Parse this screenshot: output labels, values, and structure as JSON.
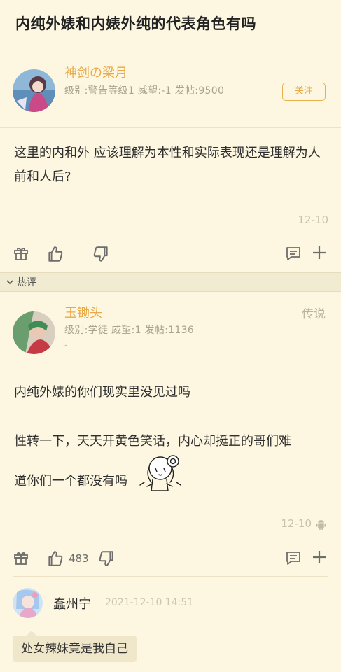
{
  "thread": {
    "title": "内纯外婊和内婊外纯的代表角色有吗"
  },
  "op": {
    "username": "神剑の梁月",
    "meta": "级别:警告等级1 威望:-1 发帖:9500",
    "dash": "-",
    "follow_label": "关注",
    "content": "这里的内和外 应该理解为本性和实际表现还是理解为人前和人后?",
    "date": "12-10"
  },
  "section": {
    "label": "热评"
  },
  "hot_reply": {
    "username": "玉锄头",
    "level_tag": "传说",
    "meta": "级别:学徒 威望:1 发帖:1136",
    "dash": "-",
    "line1": "内纯外婊的你们现实里没见过吗",
    "line2": "性转一下，天天开黄色笑话，内心却挺正的哥们难",
    "line3": "道你们一个都没有吗",
    "date": "12-10",
    "like_count": "483"
  },
  "sub_reply": {
    "username": "蠢州宁",
    "timestamp": "2021-12-10 14:51",
    "content": "处女辣妹竟是我自己"
  },
  "icons": {
    "gift": "gift-icon",
    "like": "thumbs-up-icon",
    "dislike": "thumbs-down-icon",
    "comment": "comment-icon",
    "more": "plus-icon",
    "android": "android-icon"
  },
  "colors": {
    "background": "#fdf7e1",
    "username": "#e8a948",
    "section_bar": "#f1ebd2"
  }
}
